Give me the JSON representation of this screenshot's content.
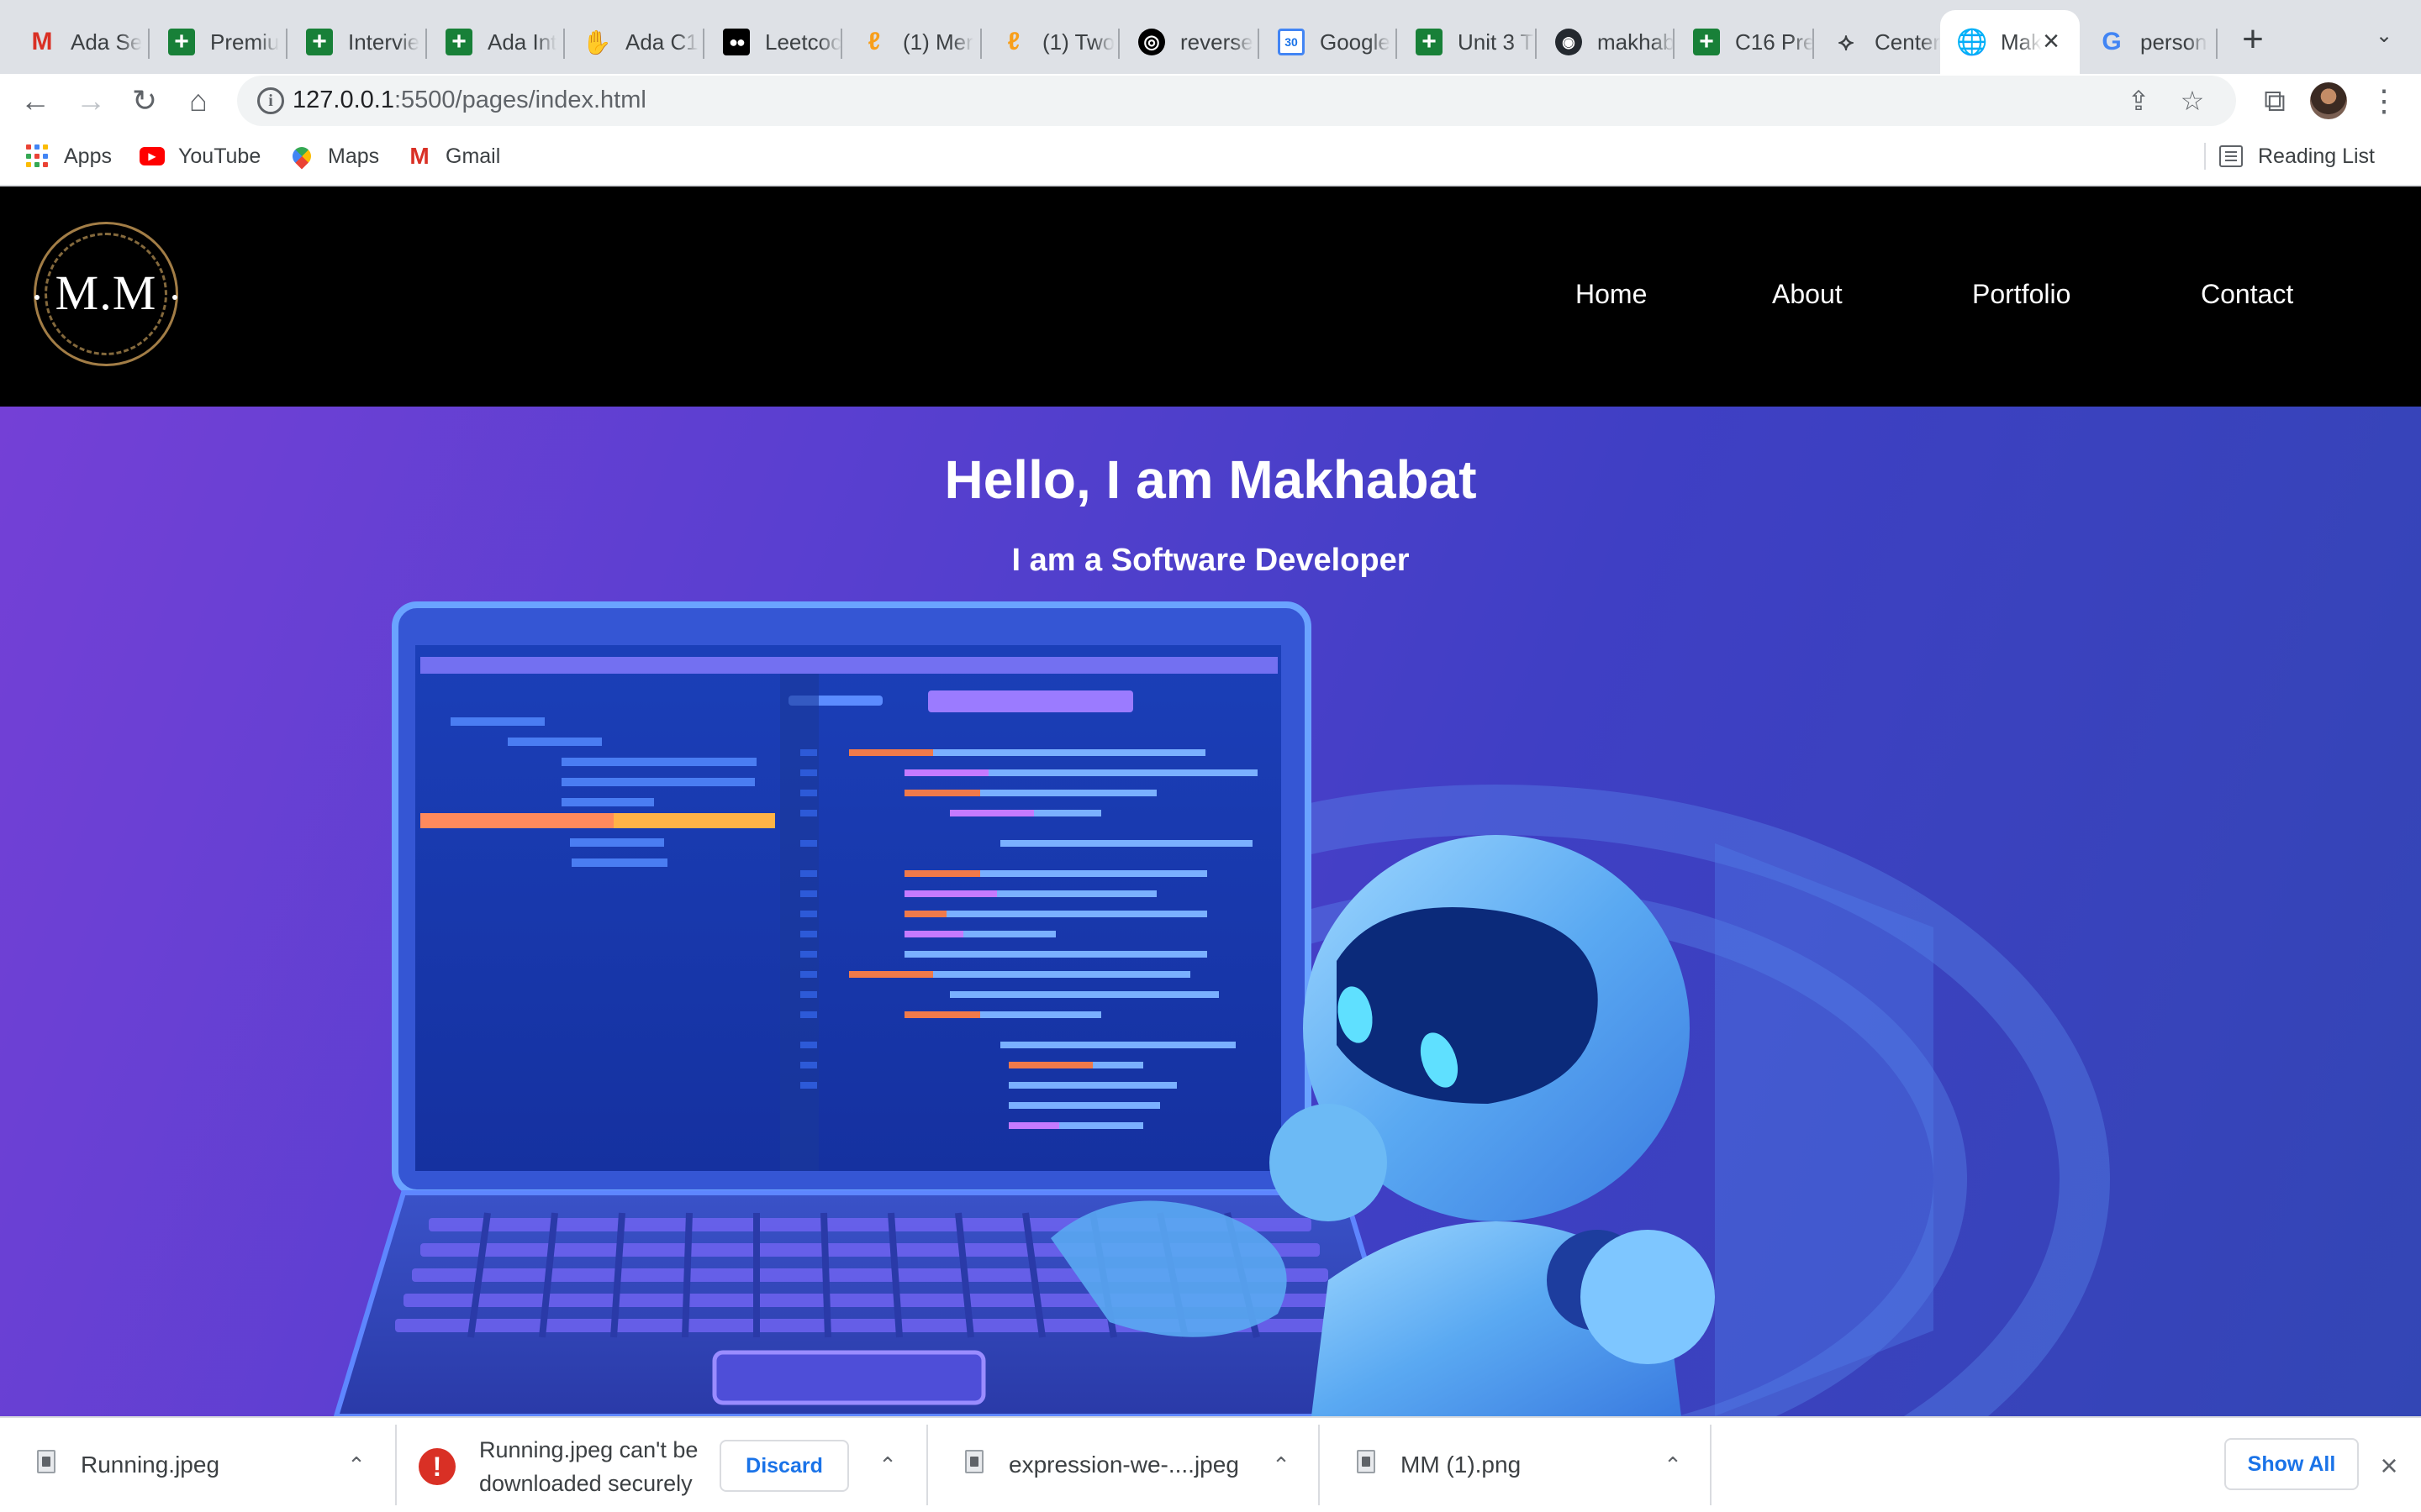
{
  "browser": {
    "tabs": [
      {
        "title": "Ada Se",
        "icon": "gmail-icon"
      },
      {
        "title": "Premiu",
        "icon": "sheets-icon"
      },
      {
        "title": "Intervie",
        "icon": "sheets-icon"
      },
      {
        "title": "Ada Int",
        "icon": "sheets-icon"
      },
      {
        "title": "Ada C1",
        "icon": "hand-icon"
      },
      {
        "title": "Leetcoc",
        "icon": "medium-icon"
      },
      {
        "title": "(1) Mer",
        "icon": "leetcode-icon"
      },
      {
        "title": "(1) Two",
        "icon": "leetcode-icon"
      },
      {
        "title": "reverse",
        "icon": "circle-icon"
      },
      {
        "title": "Google",
        "icon": "calendar-icon"
      },
      {
        "title": "Unit 3 T",
        "icon": "sheets-icon"
      },
      {
        "title": "makhab",
        "icon": "github-icon"
      },
      {
        "title": "C16 Pre",
        "icon": "sheets-icon"
      },
      {
        "title": "Centeri",
        "icon": "center-icon"
      },
      {
        "title": "Mak",
        "icon": "globe-icon"
      },
      {
        "title": "person",
        "icon": "google-icon"
      }
    ],
    "active_tab": 14,
    "url_host": "127.0.0.1",
    "url_path": ":5500/pages/index.html",
    "bookmarks": [
      "Apps",
      "YouTube",
      "Maps",
      "Gmail"
    ],
    "reading_list": "Reading List"
  },
  "site": {
    "logo_text": "M.M",
    "nav": [
      "Home",
      "About",
      "Portfolio",
      "Contact"
    ],
    "hero_title": "Hello, I am Makhabat",
    "hero_subtitle": "I am a Software Developer"
  },
  "downloads": {
    "items": [
      {
        "name": "Running.jpeg"
      },
      {
        "warning": "Running.jpeg can't be downloaded securely",
        "action": "Discard"
      },
      {
        "name": "expression-we-....jpeg"
      },
      {
        "name": "MM (1).png"
      }
    ],
    "show_all": "Show All"
  },
  "colors": {
    "nav_bg": "#000000",
    "hero_gradient_start": "#7440d6",
    "hero_gradient_end": "#3346b5",
    "link_blue": "#1a73e8",
    "error_red": "#d93025"
  }
}
